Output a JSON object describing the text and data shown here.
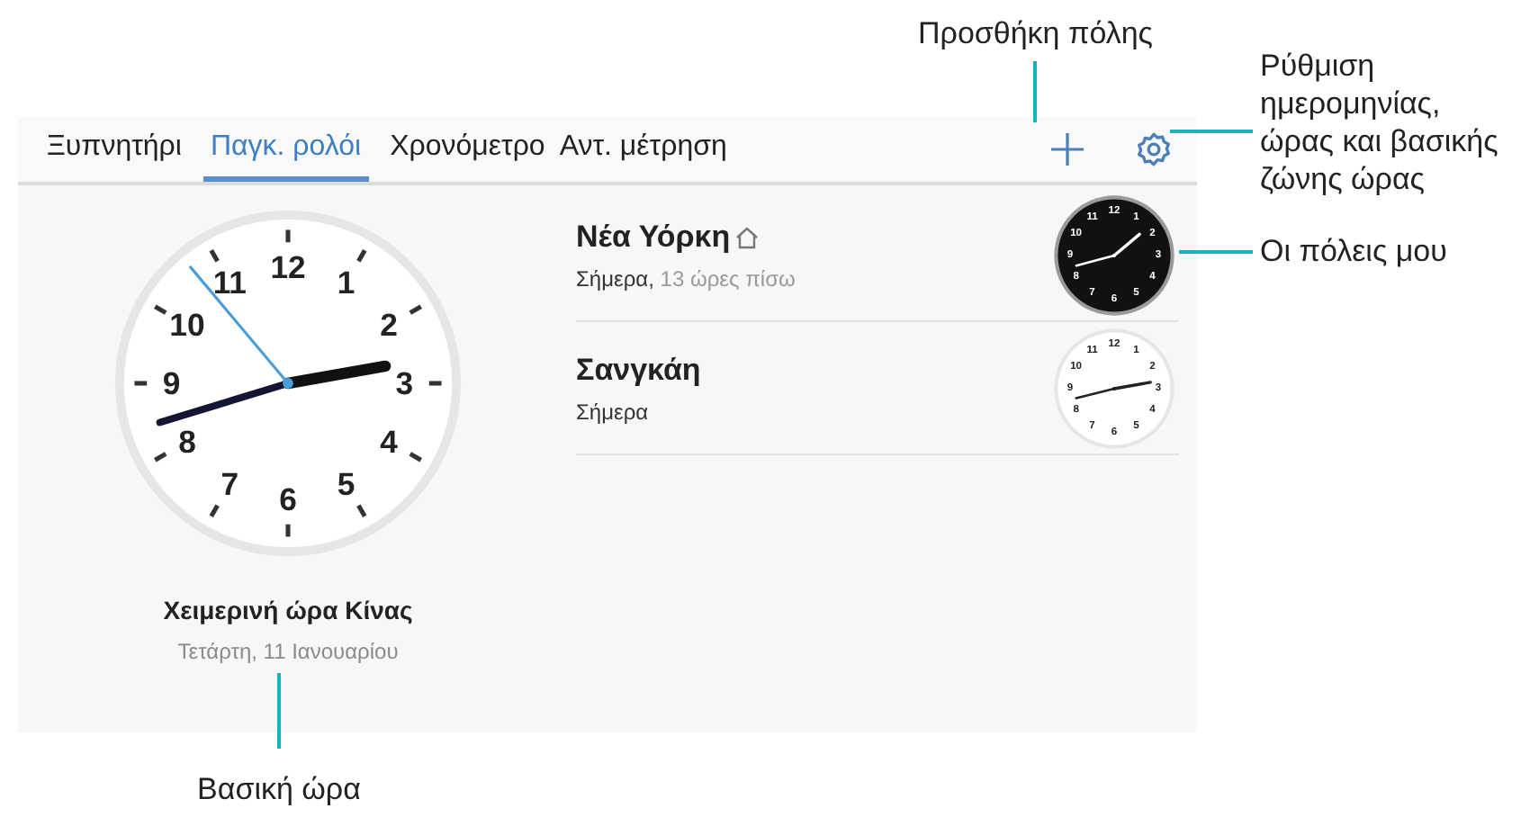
{
  "tabs": [
    {
      "label": "Ξυπνητήρι",
      "selected": false
    },
    {
      "label": "Παγκ. ρολόι",
      "selected": true
    },
    {
      "label": "Χρονόμετρο",
      "selected": false
    },
    {
      "label": "Αντ. μέτρηση",
      "selected": false
    }
  ],
  "main_clock": {
    "numerals": [
      "11",
      "12",
      "1",
      "10",
      "2",
      "9",
      "3",
      "8",
      "4",
      "7",
      "6",
      "5"
    ],
    "zone": "Χειμερινή ώρα Κίνας",
    "date": "Τετάρτη, 11 Ιανουαρίου"
  },
  "cities": [
    {
      "name": "Νέα Υόρκη",
      "home": true,
      "day": "Σήμερα,",
      "offset": "13 ώρες πίσω",
      "dark_dial": true,
      "numerals": [
        "11",
        "12",
        "1",
        "10",
        "2",
        "9",
        "3",
        "8",
        "4",
        "7",
        "6",
        "5"
      ]
    },
    {
      "name": "Σανγκάη",
      "home": false,
      "day": "Σήμερα",
      "dark_dial": false,
      "numerals": [
        "11",
        "12",
        "1",
        "10",
        "2",
        "9",
        "3",
        "8",
        "4",
        "7",
        "6",
        "5"
      ]
    }
  ],
  "callouts": [
    {
      "kind": "add",
      "text": "Προσθήκη πόλης"
    },
    {
      "kind": "settings",
      "text": "Ρύθμιση ημερομηνίας, ώρας και βασικής ζώνης ώρας"
    },
    {
      "kind": "cities",
      "text": "Οι πόλεις μου"
    },
    {
      "kind": "home",
      "text": "Βασική ώρα"
    }
  ]
}
